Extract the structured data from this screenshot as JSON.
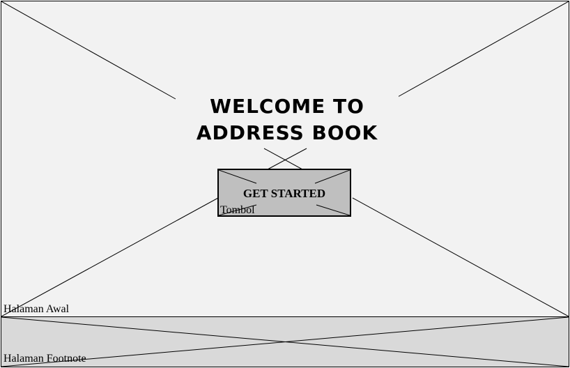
{
  "main": {
    "title_line1": "WELCOME TO",
    "title_line2": "ADDRESS BOOK",
    "frame_label": "Halaman Awal"
  },
  "button": {
    "label": "GET STARTED",
    "annotation": "Tombol"
  },
  "footer": {
    "frame_label": "Halaman Footnote"
  },
  "colors": {
    "main_background": "#f2f2f2",
    "footer_background": "#d9d9d9",
    "button_background": "#bfbfbf",
    "stroke": "#000000"
  }
}
